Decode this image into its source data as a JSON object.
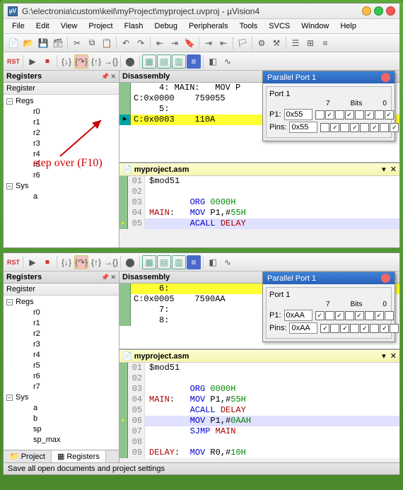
{
  "window_title": "G:\\electronia\\custom\\keil\\myProject\\myproject.uvproj - µVision4",
  "menus": [
    "File",
    "Edit",
    "View",
    "Project",
    "Flash",
    "Debug",
    "Peripherals",
    "Tools",
    "SVCS",
    "Window",
    "Help"
  ],
  "annotation": "step over (F10)",
  "panes": {
    "registers": "Registers",
    "regcol": "Register",
    "disassembly": "Disassembly"
  },
  "tabs": {
    "project": "Project",
    "registers": "Registers"
  },
  "status": "Save all open documents and project settings",
  "asm_tab": "myproject.asm",
  "regs_top": {
    "root": "Regs",
    "items": [
      "r0",
      "r1",
      "r2",
      "r3",
      "r4",
      "r5",
      "r6"
    ],
    "sys": "Sys",
    "sys_items": [
      "a"
    ]
  },
  "regs_bot": {
    "root": "Regs",
    "items": [
      "r0",
      "r1",
      "r2",
      "r3",
      "r4",
      "r5",
      "r6",
      "r7"
    ],
    "sys": "Sys",
    "sys_items": [
      "a",
      "b",
      "sp",
      "sp_max"
    ]
  },
  "disasm_top": [
    {
      "g": "",
      "y": false,
      "txt": "     4: MAIN:   MOV P"
    },
    {
      "g": "",
      "y": false,
      "txt": "C:0x0000    759055    "
    },
    {
      "g": "",
      "y": false,
      "txt": "     5:         "
    },
    {
      "g": "►",
      "y": true,
      "txt": "C:0x0003    110A     "
    }
  ],
  "disasm_bot": [
    {
      "g": "",
      "y": true,
      "txt": "     6:         "
    },
    {
      "g": "",
      "y": false,
      "txt": "C:0x0005    7590AA    "
    },
    {
      "g": "",
      "y": false,
      "txt": "     7:"
    },
    {
      "g": "",
      "y": false,
      "txt": "     8:"
    }
  ],
  "asm_top": [
    {
      "n": "01",
      "g": "",
      "hl": false,
      "cls": "",
      "txt": "$mod51"
    },
    {
      "n": "02",
      "g": "",
      "hl": false,
      "cls": "",
      "txt": ""
    },
    {
      "n": "03",
      "g": "",
      "hl": false,
      "cls": "kw",
      "txt": "        ORG 0000H"
    },
    {
      "n": "04",
      "g": "",
      "hl": false,
      "cls": "",
      "txt": "MAIN:   MOV P1,#55H"
    },
    {
      "n": "05",
      "g": "►",
      "hl": true,
      "cls": "kw",
      "txt": "        ACALL DELAY"
    }
  ],
  "asm_bot": [
    {
      "n": "01",
      "g": "",
      "hl": false,
      "cls": "",
      "txt": "$mod51"
    },
    {
      "n": "02",
      "g": "",
      "hl": false,
      "cls": "",
      "txt": ""
    },
    {
      "n": "03",
      "g": "",
      "hl": false,
      "cls": "kw",
      "txt": "        ORG 0000H"
    },
    {
      "n": "04",
      "g": "",
      "hl": false,
      "cls": "",
      "txt": "MAIN:   MOV P1,#55H"
    },
    {
      "n": "05",
      "g": "",
      "hl": false,
      "cls": "kw",
      "txt": "        ACALL DELAY"
    },
    {
      "n": "06",
      "g": "►",
      "hl": true,
      "cls": "kw",
      "txt": "        MOV P1,#0AAH"
    },
    {
      "n": "07",
      "g": "",
      "hl": false,
      "cls": "kw",
      "txt": "        SJMP MAIN"
    },
    {
      "n": "08",
      "g": "",
      "hl": false,
      "cls": "",
      "txt": ""
    },
    {
      "n": "09",
      "g": "",
      "hl": false,
      "cls": "",
      "txt": "DELAY:  MOV R0,#10H"
    }
  ],
  "port_top": {
    "title": "Parallel Port 1",
    "group": "Port 1",
    "p1_lbl": "P1:",
    "p1": "0x55",
    "pins_lbl": "Pins:",
    "pins": "0x55",
    "bithdr7": "7",
    "bithdrB": "Bits",
    "bithdr0": "0",
    "bits": [
      false,
      true,
      false,
      true,
      false,
      true,
      false,
      true
    ]
  },
  "port_bot": {
    "title": "Parallel Port 1",
    "group": "Port 1",
    "p1_lbl": "P1:",
    "p1": "0xAA",
    "pins_lbl": "Pins:",
    "pins": "0xAA",
    "bithdr7": "7",
    "bithdrB": "Bits",
    "bithdr0": "0",
    "bits": [
      true,
      false,
      true,
      false,
      true,
      false,
      true,
      false
    ]
  }
}
